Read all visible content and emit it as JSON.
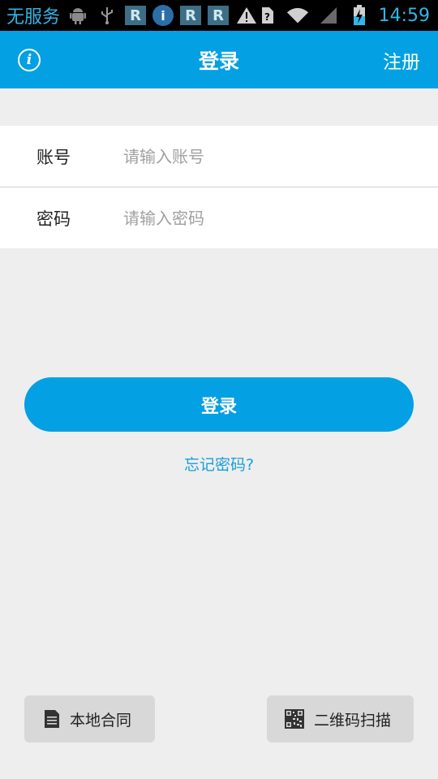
{
  "status_bar": {
    "carrier": "无服务",
    "time": "14:59",
    "icons": [
      "android-icon",
      "usb-icon",
      "r-app-icon",
      "info-app-icon",
      "r-app-icon",
      "r-app-icon",
      "warning-icon",
      "sim-icon",
      "wifi-icon",
      "signal-icon",
      "battery-charging-icon"
    ]
  },
  "app_bar": {
    "title": "登录",
    "register_label": "注册",
    "info_icon": "info-icon"
  },
  "form": {
    "account_label": "账号",
    "account_placeholder": "请输入账号",
    "account_value": "",
    "password_label": "密码",
    "password_placeholder": "请输入密码",
    "password_value": ""
  },
  "login_button": "登录",
  "forgot_password": "忘记密码?",
  "bottom": {
    "local_contract": "本地合同",
    "qr_scan": "二维码扫描"
  },
  "colors": {
    "accent": "#03a0e3",
    "background": "#eeeeee",
    "link": "#18a0da",
    "status_text": "#33b5e5"
  }
}
